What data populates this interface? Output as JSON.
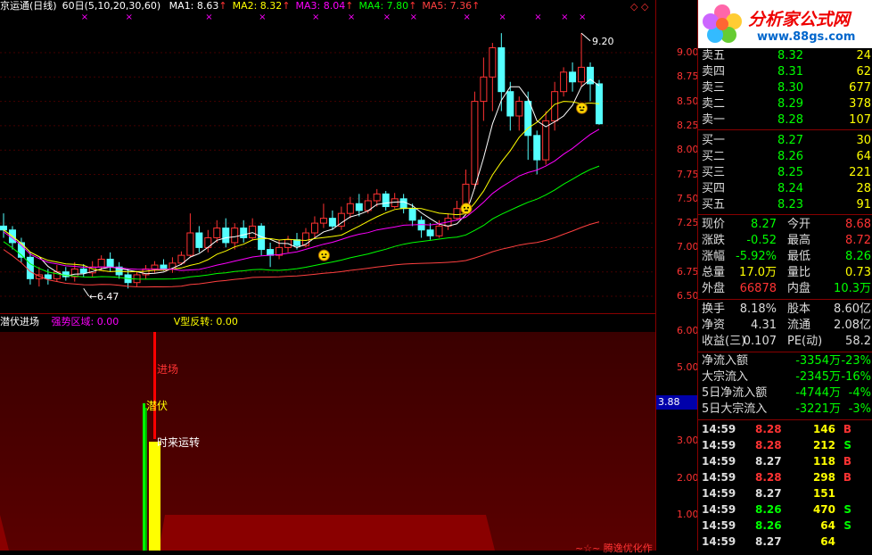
{
  "header": {
    "title": "京运通(日线)",
    "period": "60日(5,10,20,30,60)",
    "ma": [
      {
        "label": "MA1: 8.63",
        "color": "#ffffff"
      },
      {
        "label": "MA2: 8.32",
        "color": "#ffff00"
      },
      {
        "label": "MA3: 8.04",
        "color": "#ff00ff"
      },
      {
        "label": "MA4: 7.80",
        "color": "#00ff00"
      },
      {
        "label": "MA5: 7.36",
        "color": "#ff4040"
      }
    ],
    "arrow": "↑"
  },
  "price_axis": {
    "labels": [
      "9.00",
      "8.75",
      "8.50",
      "8.25",
      "8.00",
      "7.75",
      "7.50",
      "7.25",
      "7.00",
      "6.75",
      "6.50"
    ],
    "high_mark": "9.20",
    "low_mark": "6.47"
  },
  "sub_chart": {
    "indicator_name": "潜伏进场",
    "zone_label": "强势区域: 0.00",
    "v_label": "V型反转: 0.00",
    "signals": [
      "进场",
      "潜伏",
      "时来运转"
    ],
    "axis": [
      "6.00",
      "5.00",
      "3.00",
      "2.00",
      "1.00"
    ],
    "current": "3.88",
    "watermark": "~☆~ 腾逸优化作"
  },
  "logo": {
    "title": "分析家公式网",
    "url": "www.88gs.com"
  },
  "order_book": {
    "sell": [
      {
        "label": "卖五",
        "price": "8.32",
        "vol": "24"
      },
      {
        "label": "卖四",
        "price": "8.31",
        "vol": "62"
      },
      {
        "label": "卖三",
        "price": "8.30",
        "vol": "677"
      },
      {
        "label": "卖二",
        "price": "8.29",
        "vol": "378"
      },
      {
        "label": "卖一",
        "price": "8.28",
        "vol": "107"
      }
    ],
    "buy": [
      {
        "label": "买一",
        "price": "8.27",
        "vol": "30"
      },
      {
        "label": "买二",
        "price": "8.26",
        "vol": "64"
      },
      {
        "label": "买三",
        "price": "8.25",
        "vol": "221"
      },
      {
        "label": "买四",
        "price": "8.24",
        "vol": "28"
      },
      {
        "label": "买五",
        "price": "8.23",
        "vol": "91"
      }
    ]
  },
  "stats": [
    {
      "l1": "现价",
      "v1": "8.27",
      "c1": "#0f0",
      "l2": "今开",
      "v2": "8.68",
      "c2": "#f33"
    },
    {
      "l1": "涨跌",
      "v1": "-0.52",
      "c1": "#0f0",
      "l2": "最高",
      "v2": "8.72",
      "c2": "#f33"
    },
    {
      "l1": "涨幅",
      "v1": "-5.92%",
      "c1": "#0f0",
      "l2": "最低",
      "v2": "8.26",
      "c2": "#0f0"
    },
    {
      "l1": "总量",
      "v1": "17.0万",
      "c1": "#ff0",
      "l2": "量比",
      "v2": "0.73",
      "c2": "#ff0"
    },
    {
      "l1": "外盘",
      "v1": "66878",
      "c1": "#f33",
      "l2": "内盘",
      "v2": "10.3万",
      "c2": "#0f0"
    }
  ],
  "stats2": [
    {
      "l1": "换手",
      "v1": "8.18%",
      "l2": "股本",
      "v2": "8.60亿"
    },
    {
      "l1": "净资",
      "v1": "4.31",
      "l2": "流通",
      "v2": "2.08亿"
    },
    {
      "l1": "收益(三)",
      "v1": "0.107",
      "l2": "PE(动)",
      "v2": "58.2"
    }
  ],
  "flows": [
    {
      "label": "净流入额",
      "val": "-3354万",
      "pct": "-23%"
    },
    {
      "label": "大宗流入",
      "val": "-2345万",
      "pct": "-16%"
    },
    {
      "label": "5日净流入额",
      "val": "-4744万",
      "pct": "-4%"
    },
    {
      "label": "5日大宗流入",
      "val": "-3221万",
      "pct": "-3%"
    }
  ],
  "ticks": [
    {
      "t": "14:59",
      "p": "8.28",
      "v": "146",
      "d": "B"
    },
    {
      "t": "14:59",
      "p": "8.28",
      "v": "212",
      "d": "S"
    },
    {
      "t": "14:59",
      "p": "8.27",
      "v": "118",
      "d": "B"
    },
    {
      "t": "14:59",
      "p": "8.28",
      "v": "298",
      "d": "B"
    },
    {
      "t": "14:59",
      "p": "8.27",
      "v": "151",
      "d": ""
    },
    {
      "t": "14:59",
      "p": "8.26",
      "v": "470",
      "d": "S"
    },
    {
      "t": "14:59",
      "p": "8.26",
      "v": "64",
      "d": "S"
    },
    {
      "t": "14:59",
      "p": "8.27",
      "v": "64",
      "d": ""
    }
  ],
  "candles": [
    [
      7.22,
      7.18,
      7.35,
      7.1
    ],
    [
      7.18,
      7.05,
      7.22,
      6.98
    ],
    [
      7.05,
      6.9,
      7.1,
      6.85
    ],
    [
      6.9,
      6.68,
      6.95,
      6.62
    ],
    [
      6.68,
      6.72,
      6.8,
      6.6
    ],
    [
      6.72,
      6.68,
      6.78,
      6.62
    ],
    [
      6.68,
      6.75,
      6.82,
      6.65
    ],
    [
      6.75,
      6.7,
      6.8,
      6.66
    ],
    [
      6.7,
      6.78,
      6.85,
      6.65
    ],
    [
      6.78,
      6.74,
      6.83,
      6.7
    ],
    [
      6.74,
      6.8,
      6.86,
      6.7
    ],
    [
      6.8,
      6.88,
      6.92,
      6.76
    ],
    [
      6.88,
      6.8,
      6.95,
      6.75
    ],
    [
      6.8,
      6.72,
      6.85,
      6.68
    ],
    [
      6.72,
      6.64,
      6.78,
      6.58
    ],
    [
      6.64,
      6.72,
      6.76,
      6.6
    ],
    [
      6.72,
      6.78,
      6.82,
      6.68
    ],
    [
      6.78,
      6.82,
      6.86,
      6.74
    ],
    [
      6.82,
      6.78,
      6.88,
      6.76
    ],
    [
      6.78,
      6.84,
      6.9,
      6.74
    ],
    [
      6.84,
      6.92,
      6.96,
      6.82
    ],
    [
      6.92,
      7.15,
      7.35,
      6.9
    ],
    [
      7.15,
      7.0,
      7.22,
      6.95
    ],
    [
      7.0,
      7.1,
      7.18,
      6.95
    ],
    [
      7.1,
      7.2,
      7.28,
      7.05
    ],
    [
      7.2,
      7.05,
      7.3,
      7.0
    ],
    [
      7.05,
      7.2,
      7.25,
      6.98
    ],
    [
      7.2,
      7.1,
      7.28,
      7.05
    ],
    [
      7.1,
      7.22,
      7.3,
      7.08
    ],
    [
      7.22,
      6.98,
      7.25,
      6.92
    ],
    [
      6.98,
      6.92,
      7.05,
      6.8
    ],
    [
      6.92,
      7.0,
      7.08,
      6.88
    ],
    [
      7.0,
      7.08,
      7.12,
      6.95
    ],
    [
      7.08,
      7.02,
      7.15,
      6.98
    ],
    [
      7.02,
      7.15,
      7.2,
      7.0
    ],
    [
      7.15,
      7.25,
      7.32,
      7.1
    ],
    [
      7.25,
      7.3,
      7.45,
      7.2
    ],
    [
      7.3,
      7.22,
      7.38,
      7.18
    ],
    [
      7.22,
      7.35,
      7.42,
      7.18
    ],
    [
      7.35,
      7.45,
      7.52,
      7.3
    ],
    [
      7.45,
      7.38,
      7.55,
      7.32
    ],
    [
      7.38,
      7.48,
      7.55,
      7.35
    ],
    [
      7.48,
      7.55,
      7.6,
      7.42
    ],
    [
      7.55,
      7.42,
      7.58,
      7.38
    ],
    [
      7.42,
      7.5,
      7.56,
      7.4
    ],
    [
      7.5,
      7.4,
      7.55,
      7.35
    ],
    [
      7.4,
      7.28,
      7.45,
      7.22
    ],
    [
      7.28,
      7.18,
      7.32,
      7.1
    ],
    [
      7.18,
      7.12,
      7.25,
      7.08
    ],
    [
      7.12,
      7.22,
      7.28,
      7.1
    ],
    [
      7.22,
      7.3,
      7.35,
      7.18
    ],
    [
      7.3,
      7.4,
      7.48,
      7.28
    ],
    [
      7.4,
      7.65,
      7.8,
      7.38
    ],
    [
      7.65,
      8.5,
      8.6,
      7.6
    ],
    [
      8.5,
      8.75,
      8.95,
      8.3
    ],
    [
      8.75,
      9.05,
      9.1,
      8.4
    ],
    [
      9.05,
      8.6,
      9.2,
      8.4
    ],
    [
      8.6,
      8.35,
      8.7,
      8.2
    ],
    [
      8.35,
      8.5,
      8.55,
      8.2
    ],
    [
      8.5,
      8.15,
      8.6,
      7.9
    ],
    [
      8.15,
      7.9,
      8.2,
      7.75
    ],
    [
      7.9,
      8.3,
      8.4,
      7.85
    ],
    [
      8.3,
      8.6,
      8.7,
      8.2
    ],
    [
      8.6,
      8.8,
      8.85,
      8.55
    ],
    [
      8.8,
      8.7,
      8.9,
      8.6
    ],
    [
      8.7,
      8.85,
      9.2,
      8.65
    ],
    [
      8.85,
      8.68,
      8.9,
      8.5
    ],
    [
      8.68,
      8.27,
      8.72,
      8.26
    ]
  ]
}
